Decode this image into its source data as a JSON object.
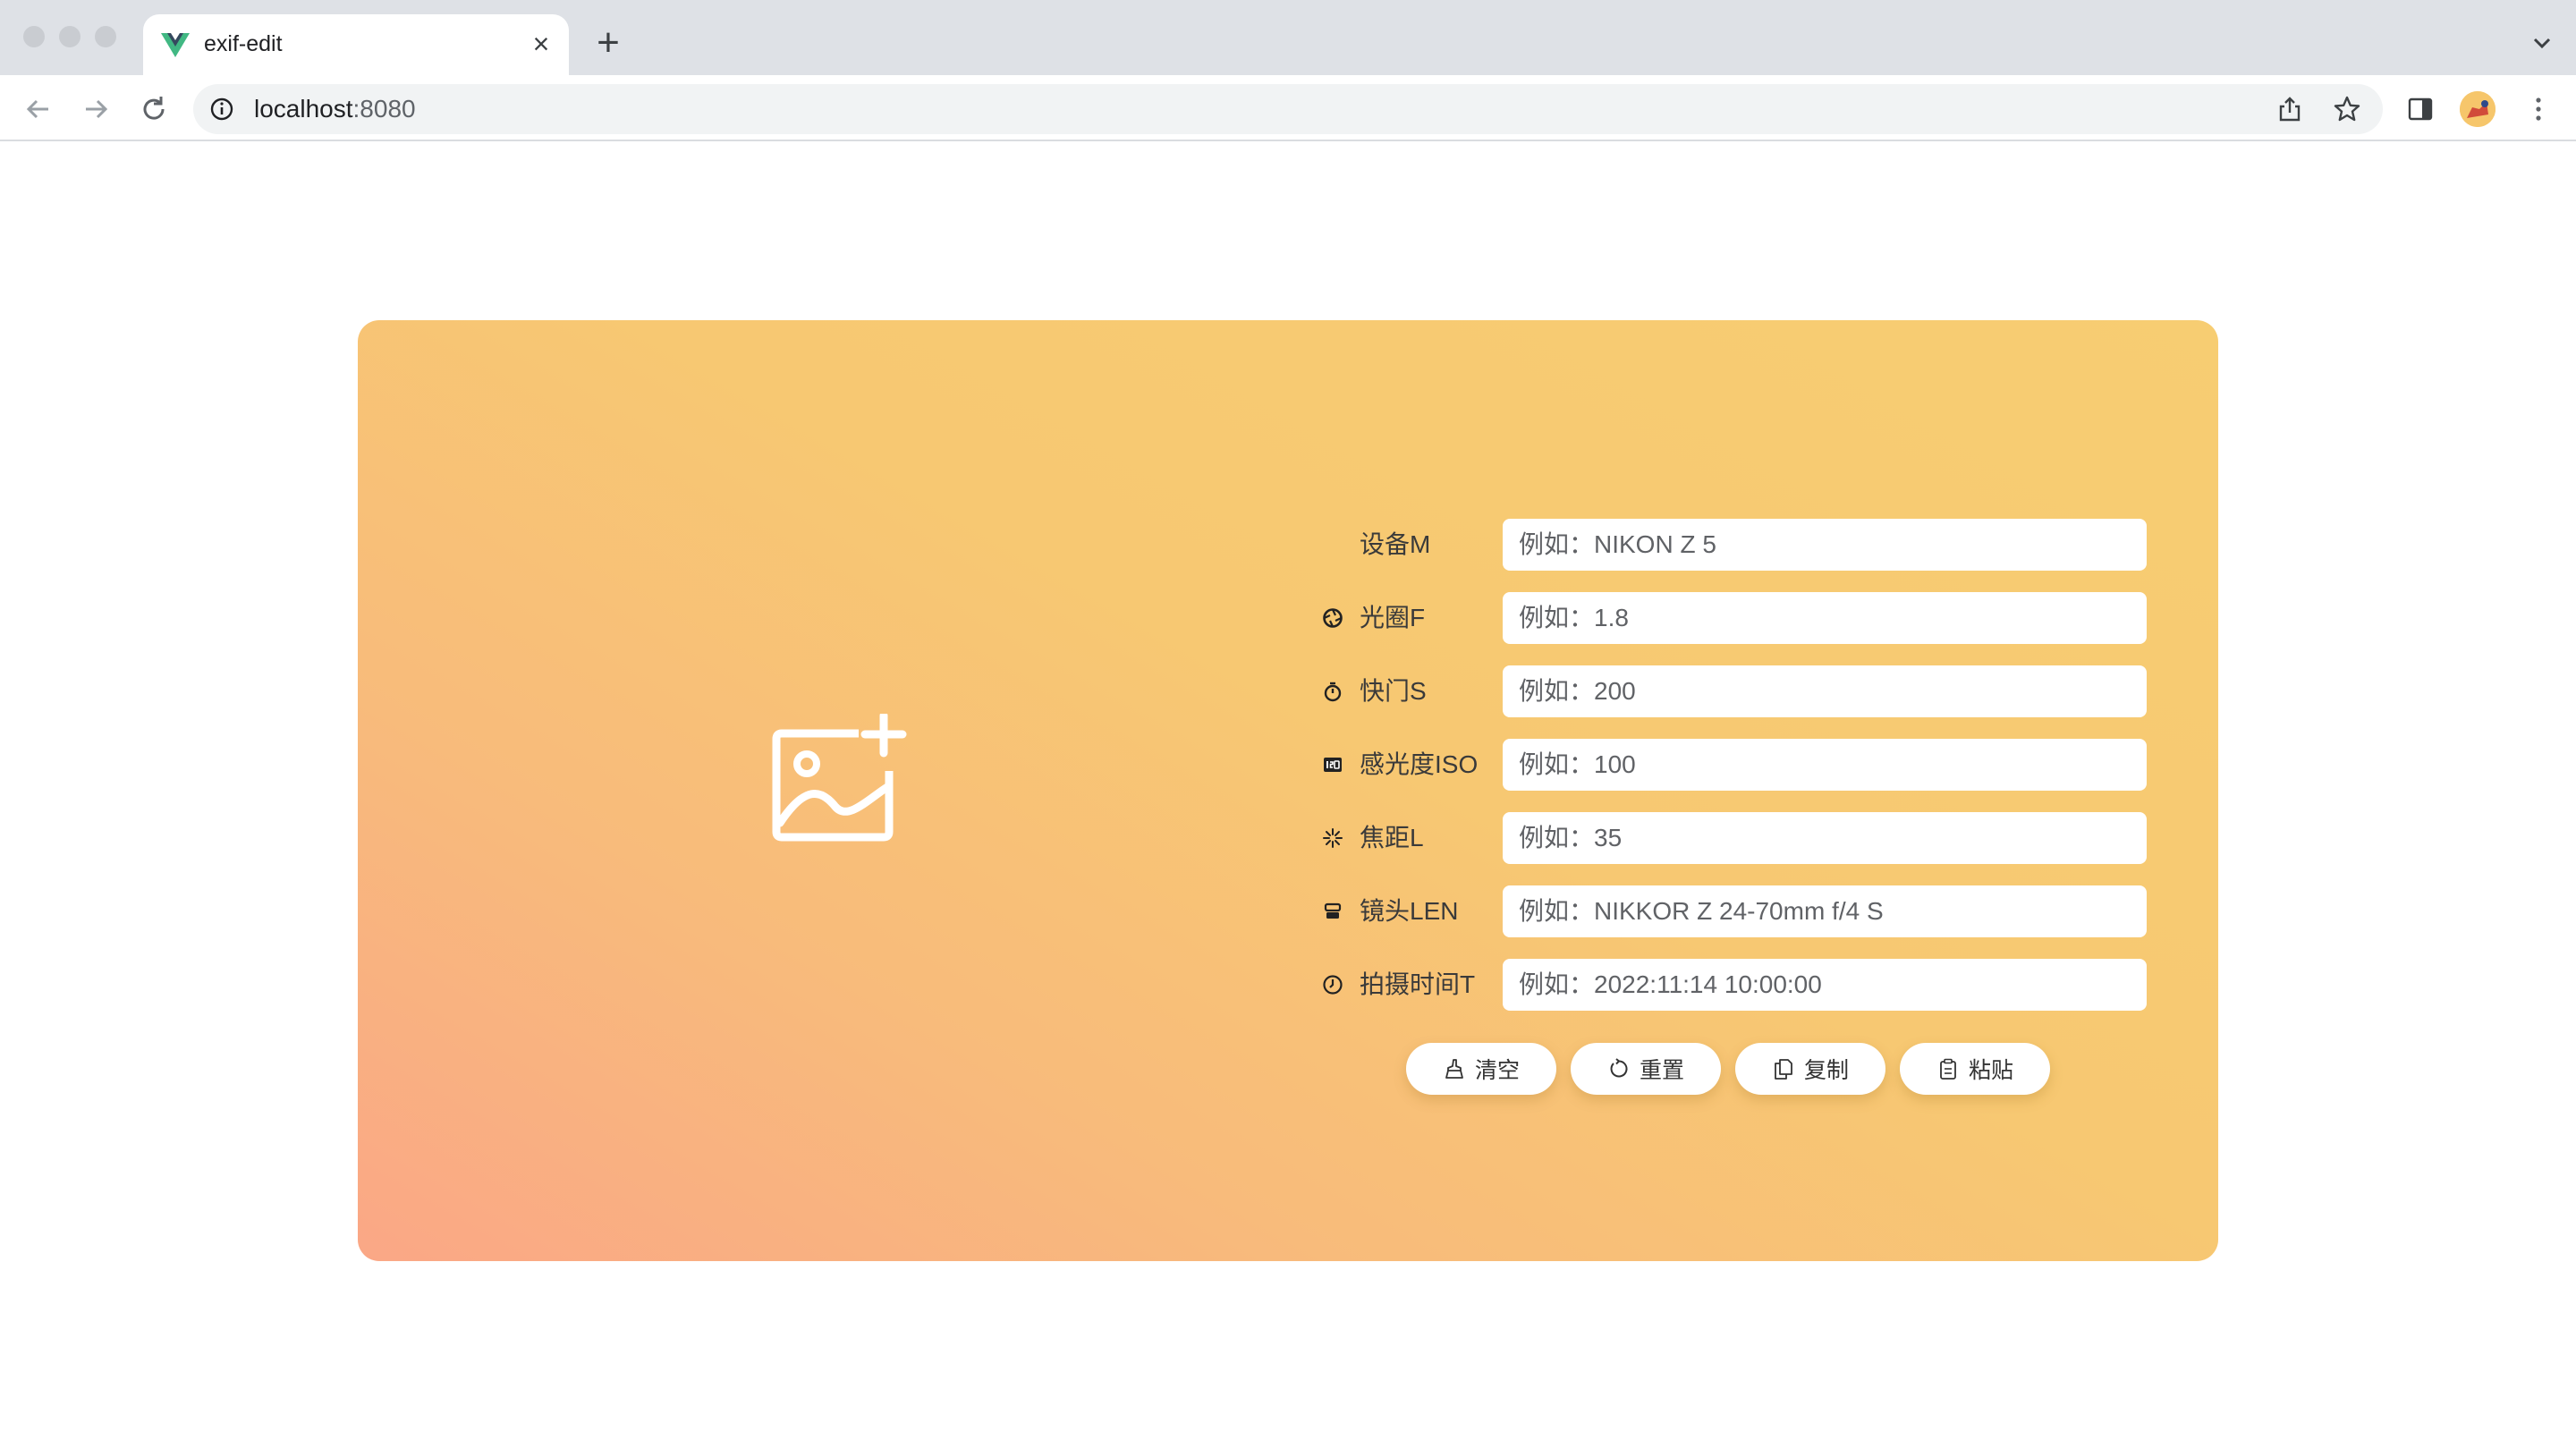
{
  "browser": {
    "tab_title": "exif-edit",
    "tab_close": "×",
    "new_tab": "+",
    "url_host": "localhost",
    "url_port": ":8080"
  },
  "upload": {
    "icon": "add-image-icon"
  },
  "form": {
    "fields": [
      {
        "label": "设备M",
        "placeholder": "例如：NIKON Z 5",
        "icon": "none"
      },
      {
        "label": "光圈F",
        "placeholder": "例如：1.8",
        "icon": "aperture-icon"
      },
      {
        "label": "快门S",
        "placeholder": "例如：200",
        "icon": "stopwatch-icon"
      },
      {
        "label": "感光度ISO",
        "placeholder": "例如：100",
        "icon": "iso-icon"
      },
      {
        "label": "焦距L",
        "placeholder": "例如：35",
        "icon": "focus-icon"
      },
      {
        "label": "镜头LEN",
        "placeholder": "例如：NIKKOR Z 24-70mm f/4 S",
        "icon": "lens-icon"
      },
      {
        "label": "拍摄时间T",
        "placeholder": "例如：2022:11:14 10:00:00",
        "icon": "clock-icon"
      }
    ]
  },
  "actions": {
    "clear": "清空",
    "reset": "重置",
    "copy": "复制",
    "paste": "粘贴"
  },
  "colors": {
    "gradient_start": "#faa786",
    "gradient_end": "#f7cd72"
  }
}
